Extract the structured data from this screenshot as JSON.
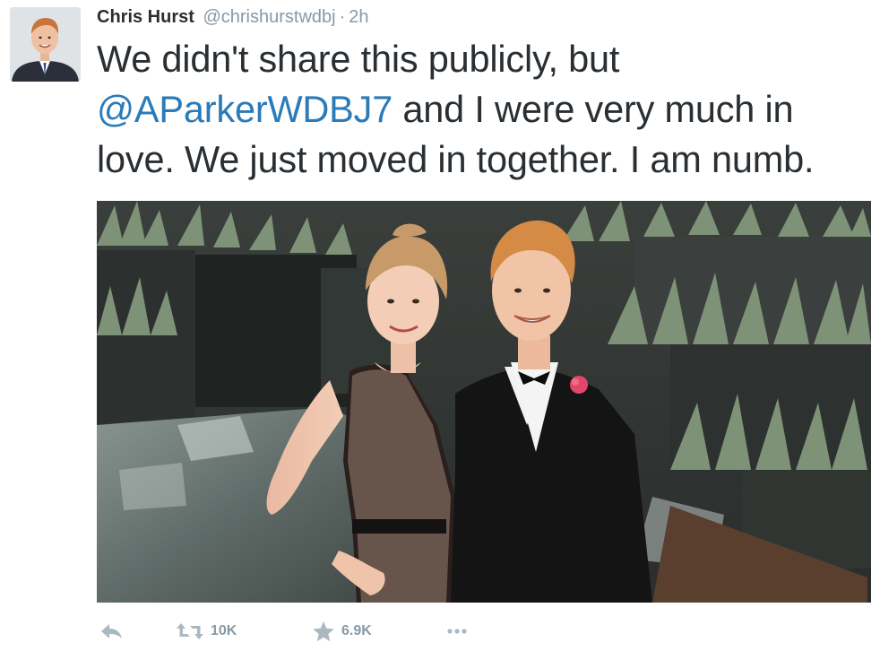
{
  "tweet": {
    "author_name": "Chris Hurst",
    "author_handle": "@chrishurstwdbj",
    "separator": "·",
    "timestamp": "2h",
    "text_part1": "We didn't share this publicly, but",
    "mention": "@AParkerWDBJ7",
    "text_part2": " and I were very much in love. We just moved in together. I am numb."
  },
  "actions": {
    "reply_icon": "reply-icon",
    "retweet_icon": "retweet-icon",
    "retweet_count": "10K",
    "favorite_icon": "star-icon",
    "favorite_count": "6.9K",
    "more_icon": "more-dots-icon"
  },
  "colors": {
    "link": "#2b7bb9",
    "meta": "#8899a6",
    "icon": "#aab8c2",
    "text": "#292f33"
  }
}
